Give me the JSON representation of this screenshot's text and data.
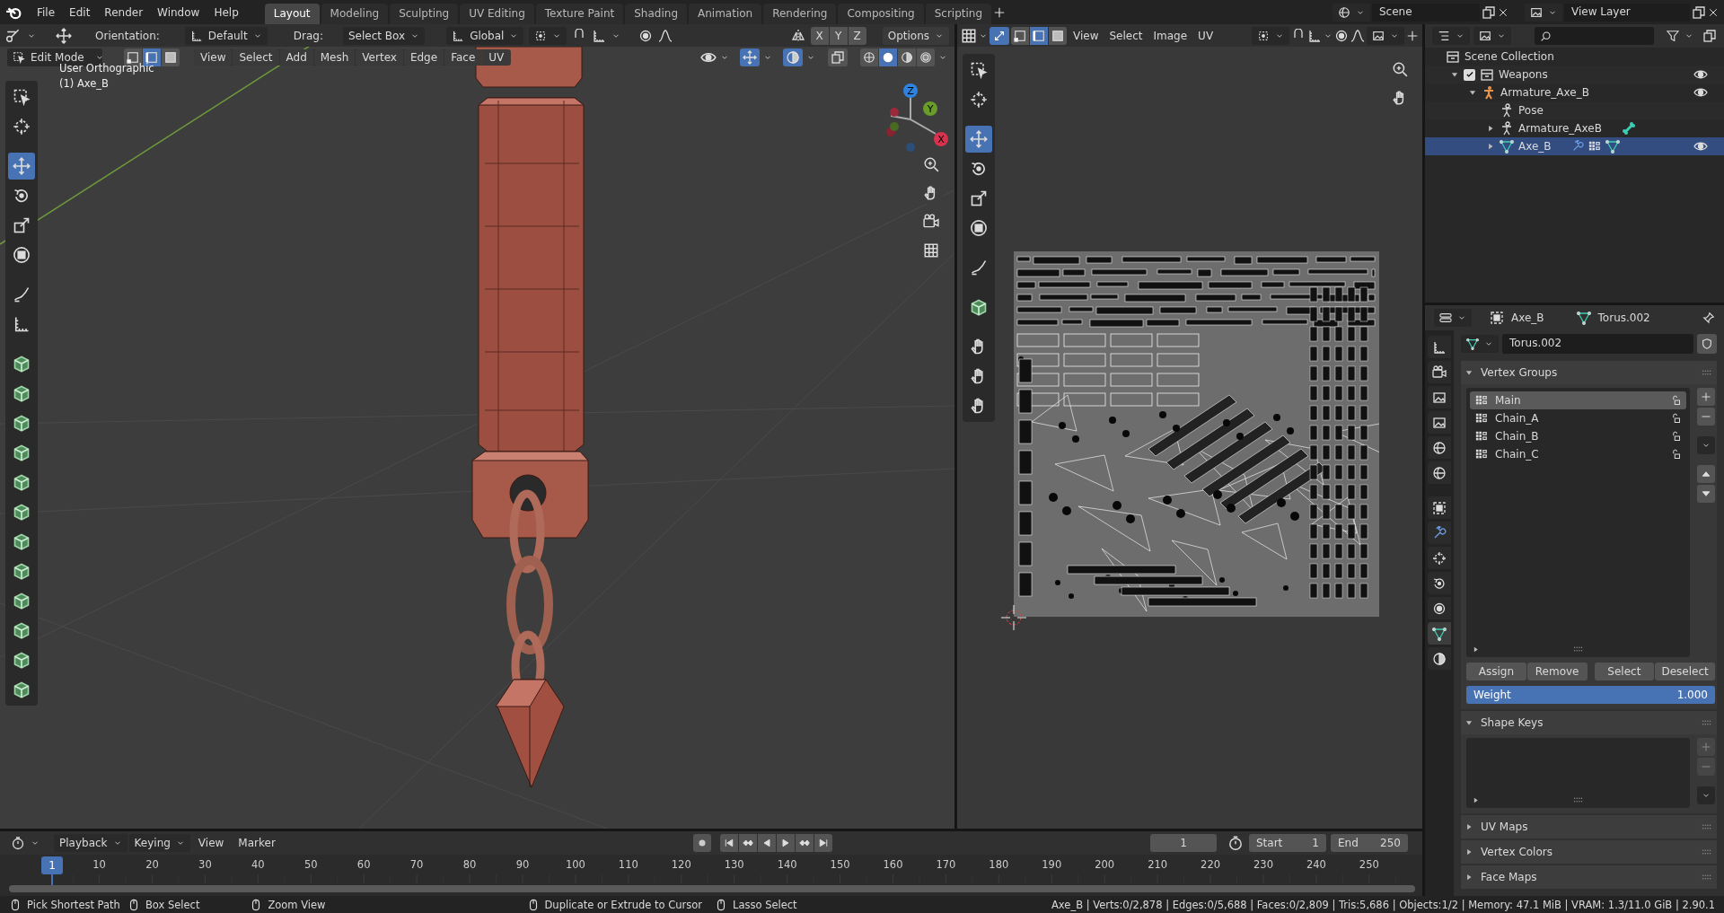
{
  "top_bar": {
    "menus": [
      "File",
      "Edit",
      "Render",
      "Window",
      "Help"
    ],
    "workspaces": [
      {
        "label": "Layout",
        "selected": true
      },
      {
        "label": "Modeling",
        "selected": false
      },
      {
        "label": "Sculpting",
        "selected": false
      },
      {
        "label": "UV Editing",
        "selected": false
      },
      {
        "label": "Texture Paint",
        "selected": false
      },
      {
        "label": "Shading",
        "selected": false
      },
      {
        "label": "Animation",
        "selected": false
      },
      {
        "label": "Rendering",
        "selected": false
      },
      {
        "label": "Compositing",
        "selected": false
      },
      {
        "label": "Scripting",
        "selected": false
      }
    ],
    "scene": "Scene",
    "view_layer": "View Layer"
  },
  "viewport": {
    "orientation_label": "Orientation:",
    "orientation": "Default",
    "drag_label": "Drag:",
    "drag": "Select Box",
    "transform": "Global",
    "mirror": [
      {
        "label": "X",
        "on": false
      },
      {
        "label": "Y",
        "on": false
      },
      {
        "label": "Z",
        "on": false
      }
    ],
    "options": "Options",
    "mode": "Edit Mode",
    "select_modes": [
      {
        "selected": false
      },
      {
        "selected": true
      },
      {
        "selected": false
      }
    ],
    "menus": [
      "View",
      "Select",
      "Add",
      "Mesh",
      "Vertex",
      "Edge",
      "Face",
      "UV"
    ],
    "shading_modes": [
      {
        "selected": false
      },
      {
        "selected": true
      },
      {
        "selected": false
      },
      {
        "selected": false
      }
    ],
    "view_name": "User Orthographic",
    "object_label": "(1) Axe_B",
    "gizmo_axes": [
      "Z",
      "Y",
      "X"
    ],
    "tools": [
      {
        "selected": false
      },
      {
        "selected": false
      },
      {
        "selected": true
      },
      {
        "selected": false
      },
      {
        "selected": false
      },
      {
        "selected": false
      },
      {
        "selected": false
      },
      {
        "selected": false
      },
      {
        "selected": false
      },
      {
        "selected": false
      },
      {
        "selected": false
      },
      {
        "selected": false
      },
      {
        "selected": false
      },
      {
        "selected": false
      },
      {
        "selected": false
      },
      {
        "selected": false
      },
      {
        "selected": false
      },
      {
        "selected": false
      },
      {
        "selected": false
      },
      {
        "selected": false
      }
    ]
  },
  "uv_editor": {
    "sync_selection": true,
    "select_modes": [
      {
        "selected": false
      },
      {
        "selected": true
      },
      {
        "selected": false
      }
    ],
    "menus": [
      "View",
      "Select",
      "Image",
      "UV"
    ],
    "tools": [
      {
        "selected": false
      },
      {
        "selected": false
      },
      {
        "selected": true
      },
      {
        "selected": false
      },
      {
        "selected": false
      },
      {
        "selected": false
      },
      {
        "selected": false
      },
      {
        "selected": false
      },
      {
        "selected": false
      },
      {
        "selected": false
      },
      {
        "selected": false
      }
    ]
  },
  "outliner": {
    "root": {
      "label": "Scene Collection",
      "kind": "collection",
      "selected": false,
      "visible": false,
      "children": [
        {
          "label": "Weapons",
          "kind": "collection",
          "checked": true,
          "expanded": true,
          "selected": false,
          "visible": true,
          "children": [
            {
              "label": "Armature_Axe_B",
              "kind": "armature",
              "expanded": true,
              "selected": false,
              "visible": true,
              "children": [
                {
                  "label": "Pose",
                  "kind": "pose",
                  "selected": false,
                  "visible": false
                },
                {
                  "label": "Armature_AxeB",
                  "kind": "armature_data",
                  "expanded": false,
                  "selected": false,
                  "visible": false
                },
                {
                  "label": "Axe_B",
                  "kind": "mesh",
                  "expanded": false,
                  "selected": true,
                  "visible": true
                }
              ]
            }
          ]
        }
      ]
    }
  },
  "properties": {
    "object": "Axe_B",
    "mesh": "Torus.002",
    "tabs": [
      {
        "selected": false
      },
      {
        "selected": false
      },
      {
        "selected": false
      },
      {
        "selected": false
      },
      {
        "selected": false
      },
      {
        "selected": false
      },
      {
        "selected": false
      },
      {
        "selected": false
      },
      {
        "selected": false
      },
      {
        "selected": false
      },
      {
        "selected": false
      },
      {
        "selected": true
      },
      {
        "selected": false
      }
    ],
    "datablock": "Torus.002",
    "panels": [
      {
        "kind": "vertex_groups",
        "title": "Vertex Groups",
        "expanded": true
      },
      {
        "kind": "shape_keys",
        "title": "Shape Keys",
        "expanded": true
      },
      {
        "title": "UV Maps",
        "expanded": false
      },
      {
        "title": "Vertex Colors",
        "expanded": false
      },
      {
        "title": "Face Maps",
        "expanded": false
      }
    ],
    "vertex_groups": [
      {
        "label": "Main",
        "selected": true
      },
      {
        "label": "Chain_A",
        "selected": false
      },
      {
        "label": "Chain_B",
        "selected": false
      },
      {
        "label": "Chain_C",
        "selected": false
      }
    ],
    "group_buttons": [
      "Assign",
      "Remove",
      "Select",
      "Deselect"
    ],
    "weight": {
      "label": "Weight",
      "reading": "1.000",
      "level": 1
    }
  },
  "timeline": {
    "menus": [
      {
        "label": "Playback",
        "kind": "dropdown"
      },
      {
        "label": "Keying",
        "kind": "dropdown"
      },
      {
        "label": "View",
        "kind": "menu"
      },
      {
        "label": "Marker",
        "kind": "menu"
      }
    ],
    "current_frame": "1",
    "start_label": "Start",
    "start": "1",
    "end_label": "End",
    "end": "250",
    "playhead": "1",
    "ruler_labels": [
      "10",
      "20",
      "30",
      "40",
      "50",
      "60",
      "70",
      "80",
      "90",
      "100",
      "110",
      "120",
      "130",
      "140",
      "150",
      "160",
      "170",
      "180",
      "190",
      "200",
      "210",
      "220",
      "230",
      "240",
      "250"
    ]
  },
  "status_bar": {
    "hints": [
      "Pick Shortest Path",
      "Box Select",
      "Zoom View",
      "Duplicate or Extrude to Cursor",
      "Lasso Select"
    ],
    "stats": "Axe_B | Verts:0/2,878 | Edges:0/5,688 | Faces:0/2,809 | Tris:5,686 | Objects:1/2 | Memory: 47.1 MiB | VRAM: 1.3/11.0 GiB | 2.90.1"
  }
}
